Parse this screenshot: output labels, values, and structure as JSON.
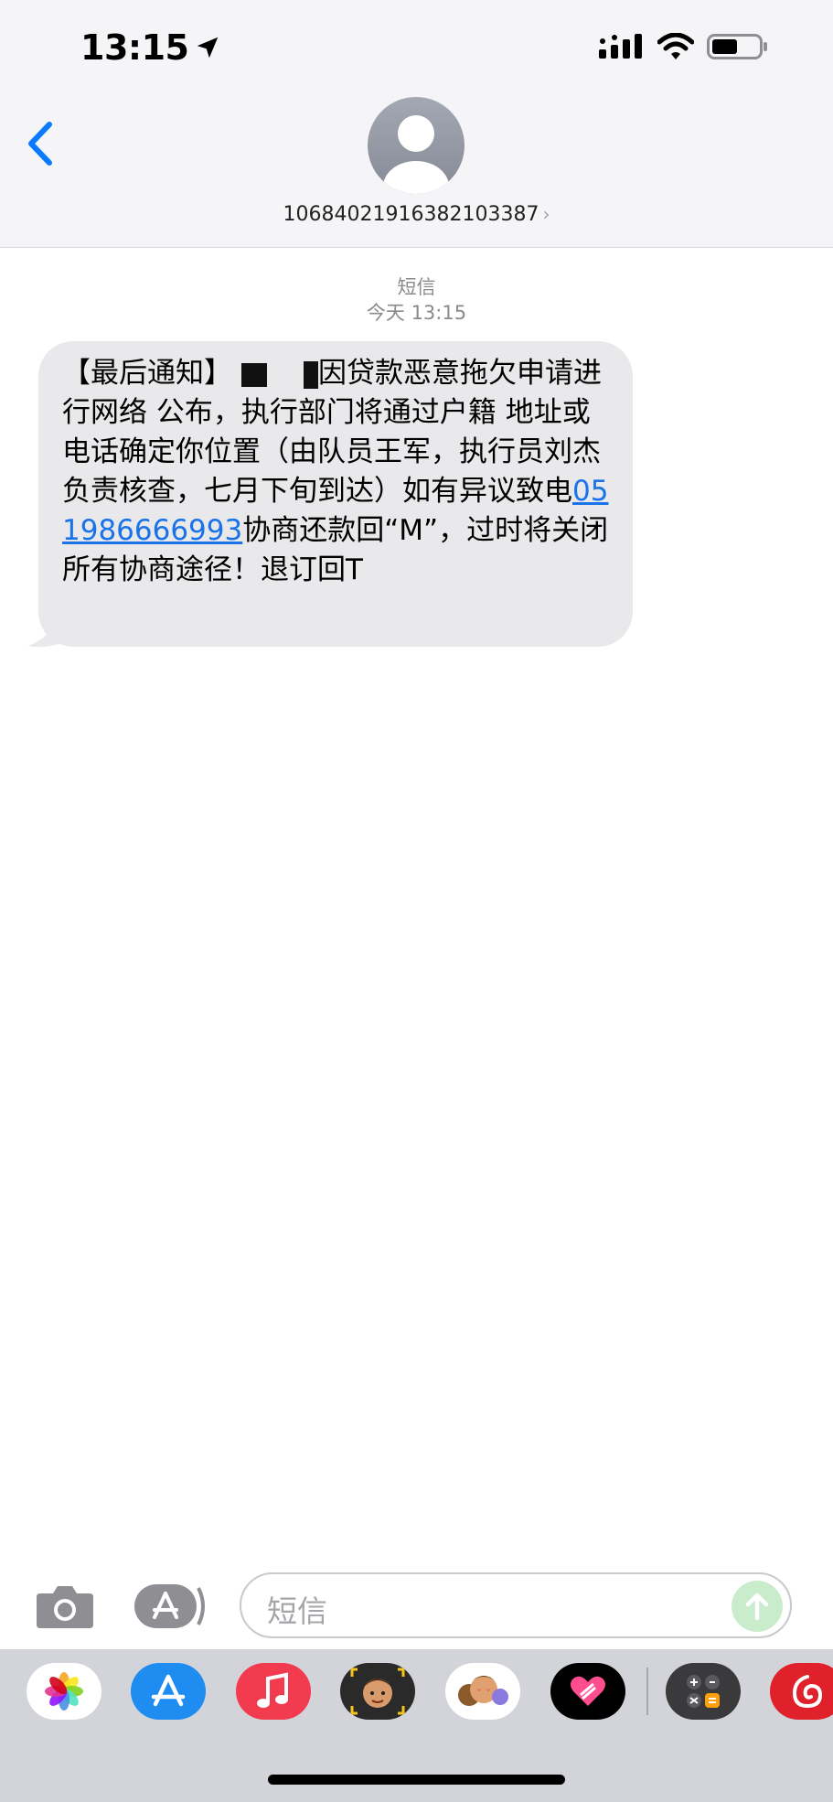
{
  "status_bar": {
    "time": "13:15",
    "location_icon": "location-arrow-icon",
    "signal_icon": "cellular-signal-icon",
    "wifi_icon": "wifi-icon",
    "battery_icon": "battery-icon"
  },
  "header": {
    "back_icon": "chevron-left-icon",
    "contact_number": "10684021916382103387",
    "contact_chevron": "›"
  },
  "thread": {
    "service_label": "短信",
    "timestamp": "今天 13:15",
    "message": {
      "part1": "【最后通知】",
      "part2": "因贷款恶意拖欠申请进行网络 公布，执行部门将通过户籍 地址或电话确定你位置（由队员王军，执行员刘杰负责核查，七月下旬到达）如有异议致电",
      "phone_link": "051986666993",
      "part3": "协商还款回“M”，过时将关闭所有协商途径！退订回T"
    }
  },
  "composer": {
    "placeholder": "短信",
    "camera_icon": "camera-icon",
    "apps_icon": "app-store-icon",
    "send_icon": "arrow-up-icon"
  },
  "app_tray": [
    {
      "name": "photos-icon"
    },
    {
      "name": "app-store-icon"
    },
    {
      "name": "music-icon"
    },
    {
      "name": "memoji-icon"
    },
    {
      "name": "animoji-stickers-icon"
    },
    {
      "name": "digital-touch-icon"
    },
    {
      "name": "calculator-icon"
    },
    {
      "name": "netease-music-icon"
    }
  ],
  "colors": {
    "accent": "#1a73e8",
    "ios_blue": "#0a7aff",
    "bubble": "#e9e9eb",
    "send_disabled": "#c9edcc"
  }
}
